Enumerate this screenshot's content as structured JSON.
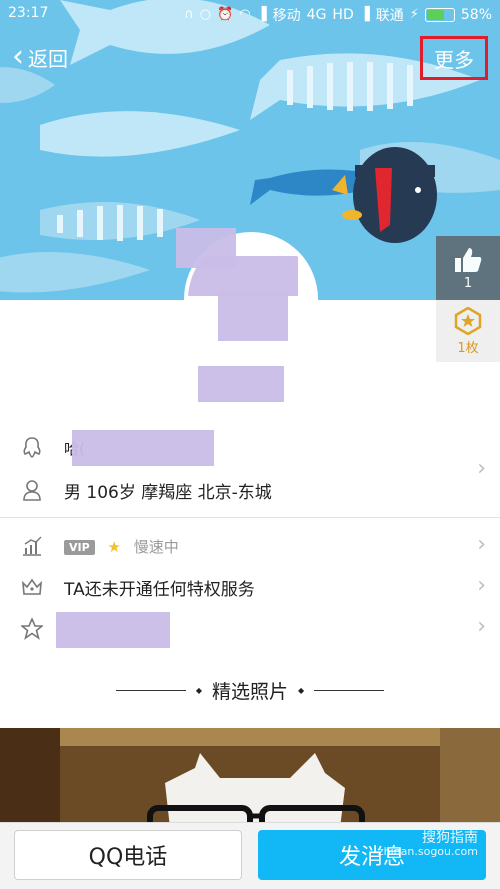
{
  "status_bar": {
    "time": "23:17",
    "carrier1": "移动",
    "network": "4G",
    "hd": "HD",
    "carrier2": "联通",
    "battery": "58%"
  },
  "nav": {
    "back_label": "返回",
    "more_label": "更多"
  },
  "like": {
    "count": "1"
  },
  "badge": {
    "count_label": "1枚"
  },
  "profile": {
    "qq_prefix": "哈(",
    "info": "男  106岁  摩羯座  北京-东城",
    "vip_tag": "VIP",
    "vip_status": "慢速中",
    "privilege": "TA还未开通任何特权服务"
  },
  "photos": {
    "title": "精选照片"
  },
  "bottom": {
    "call_label": "QQ电话",
    "message_label": "发消息",
    "watermark_1": "搜狗指南",
    "watermark_2": "zhinan.sogou.com"
  },
  "colors": {
    "cover_bg": "#6cc4ea",
    "highlight_box": "#e01e2b",
    "message_button": "#12b7f5"
  }
}
